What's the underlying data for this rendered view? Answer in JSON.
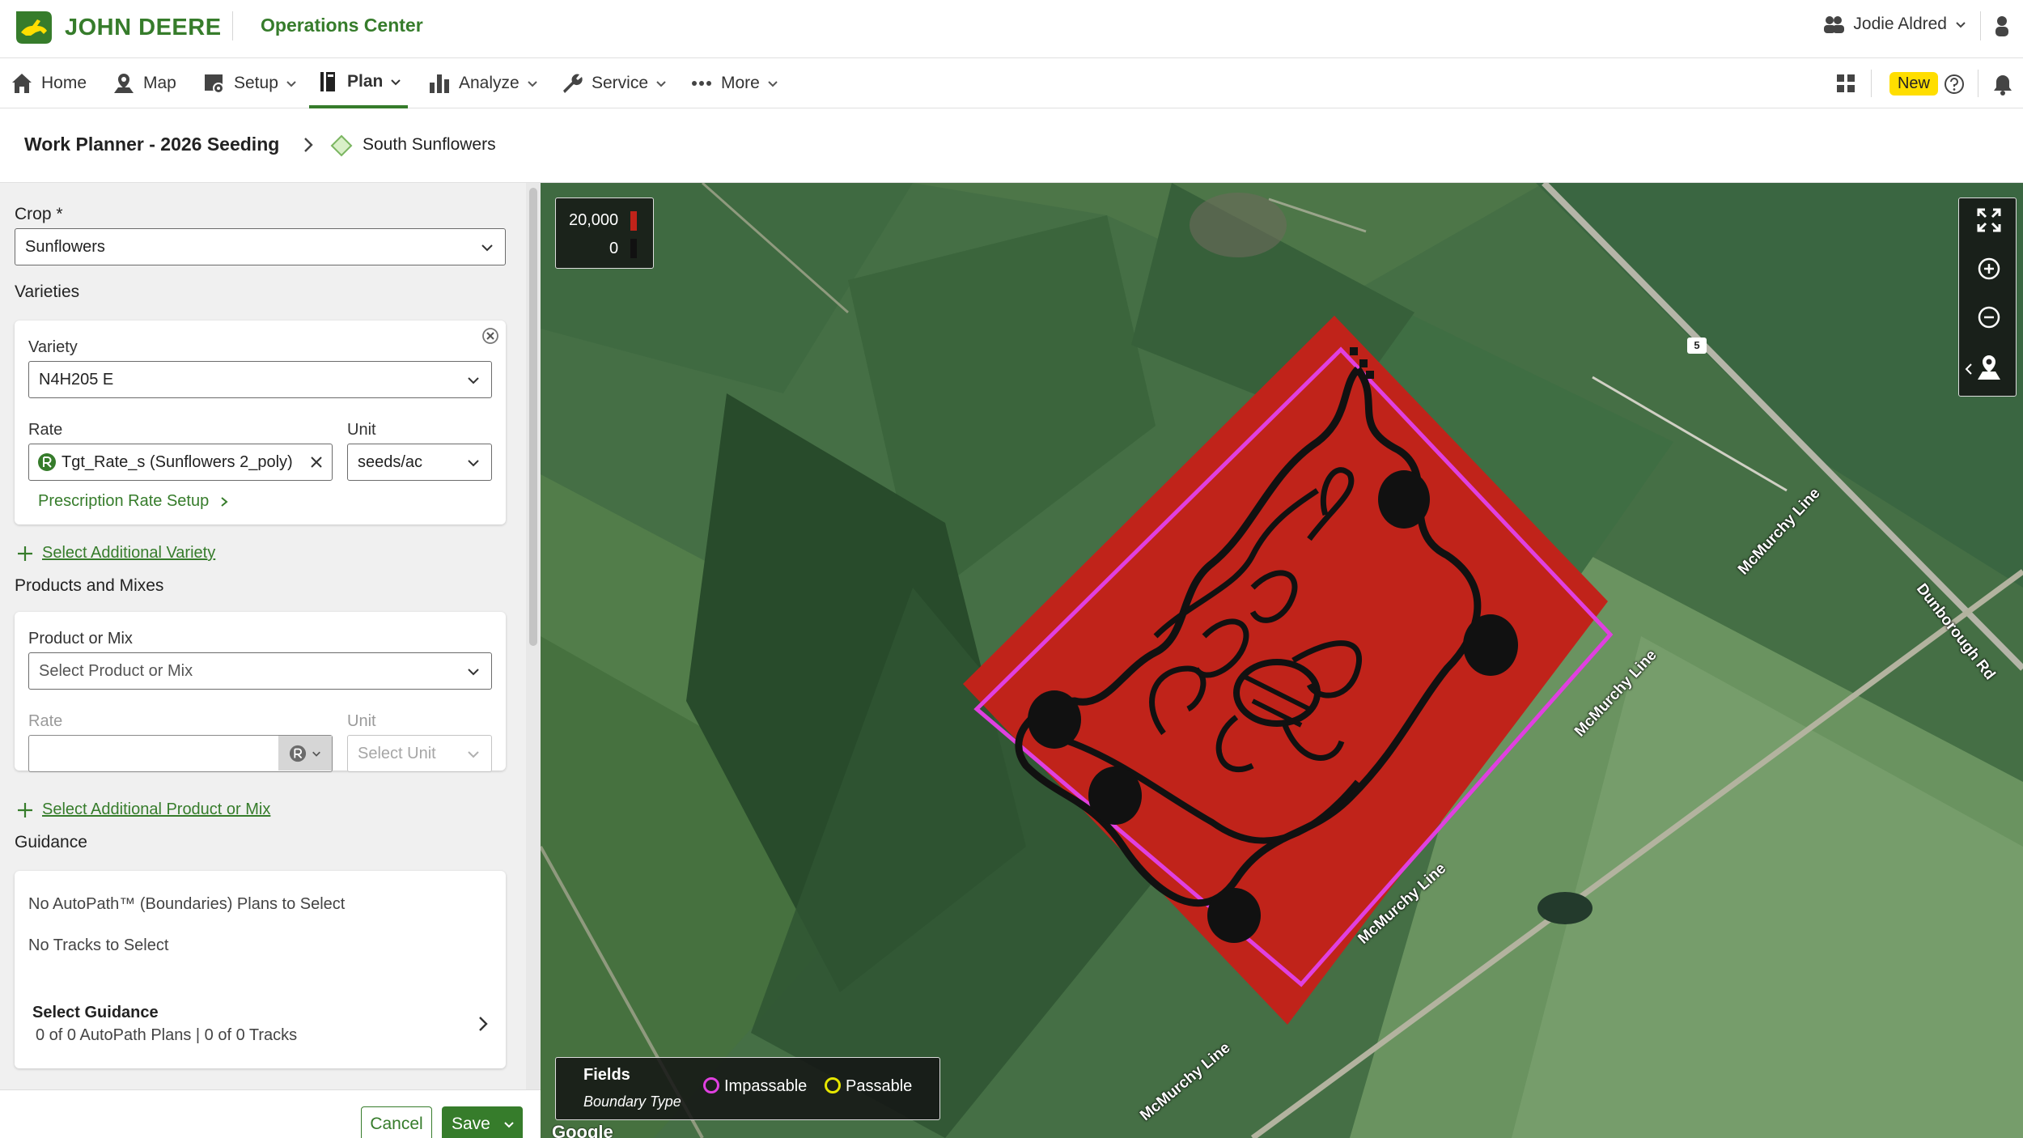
{
  "brand": {
    "name": "JOHN DEERE",
    "app_title": "Operations Center",
    "color": "#367c2b",
    "accent_yellow": "#ffde00"
  },
  "user": {
    "name": "Jodie Aldred"
  },
  "nav": {
    "items": [
      {
        "label": "Home",
        "icon": "home-icon"
      },
      {
        "label": "Map",
        "icon": "map-pin-icon"
      },
      {
        "label": "Setup",
        "icon": "setup-icon"
      },
      {
        "label": "Plan",
        "icon": "plan-icon",
        "active": true
      },
      {
        "label": "Analyze",
        "icon": "bar-chart-icon"
      },
      {
        "label": "Service",
        "icon": "wrench-icon"
      },
      {
        "label": "More",
        "icon": "more-dots-icon"
      }
    ],
    "new_badge": "New"
  },
  "breadcrumb": {
    "planner": "Work Planner - 2026 Seeding",
    "field": "South Sunflowers"
  },
  "form": {
    "crop_label": "Crop *",
    "crop_value": "Sunflowers",
    "varieties_heading": "Varieties",
    "variety_label": "Variety",
    "variety_value": "N4H205 E",
    "rate_label": "Rate",
    "rate_value": "Tgt_Rate_s (Sunflowers 2_poly)",
    "unit_label": "Unit",
    "unit_value": "seeds/ac",
    "prescription_link": "Prescription Rate Setup",
    "add_variety": "Select Additional Variety",
    "products_heading": "Products and Mixes",
    "product_label": "Product or Mix",
    "product_placeholder": "Select Product or Mix",
    "product_rate_label": "Rate",
    "product_unit_label": "Unit",
    "product_unit_placeholder": "Select Unit",
    "add_product": "Select Additional Product or Mix",
    "guidance_heading": "Guidance",
    "no_autopath": "No AutoPath™ (Boundaries) Plans to Select",
    "no_tracks": "No Tracks to Select",
    "select_guidance": "Select Guidance",
    "guidance_summary": "0 of 0 AutoPath Plans | 0 of 0 Tracks"
  },
  "buttons": {
    "cancel": "Cancel",
    "save": "Save"
  },
  "map": {
    "legend_max": "20,000",
    "legend_min": "0",
    "rate_color": "#c0231a",
    "fields_title": "Fields",
    "boundary_type": "Boundary Type",
    "impassable": "Impassable",
    "passable": "Passable",
    "impassable_color": "#e040e0",
    "passable_color": "#e6e600",
    "roads": [
      "McMurchy Line",
      "McMurchy Line",
      "McMurchy Line",
      "McMurchy Line",
      "Dunborough Rd"
    ],
    "highway_shield": "5",
    "attribution": "Google"
  }
}
